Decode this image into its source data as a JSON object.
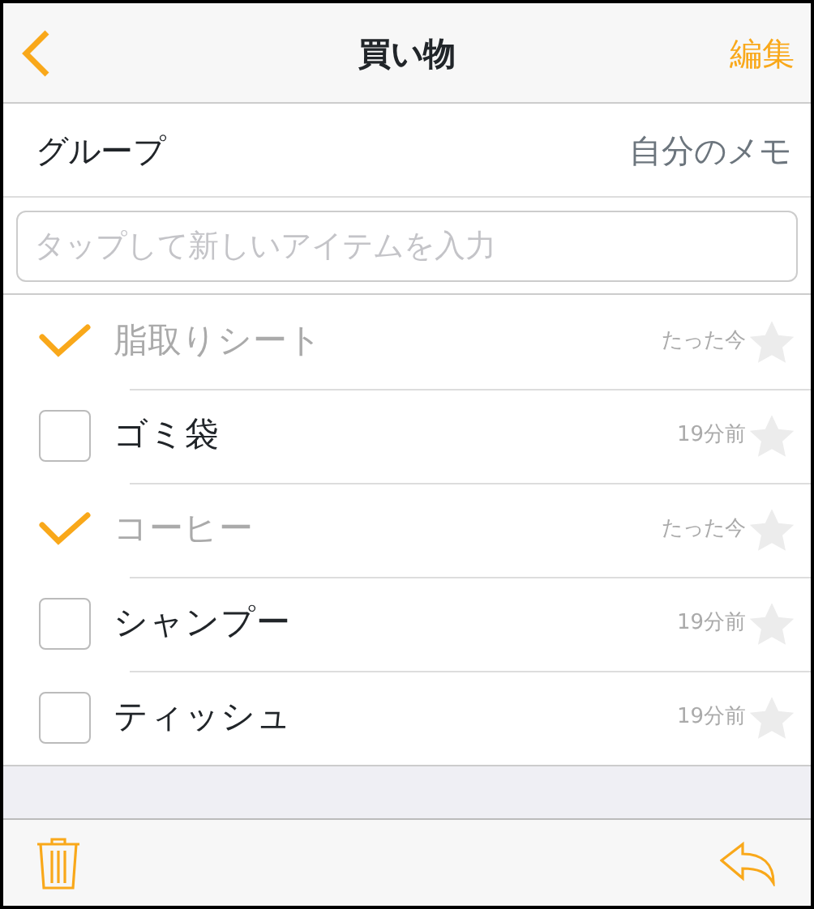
{
  "nav": {
    "title": "買い物",
    "edit": "編集"
  },
  "group": {
    "label": "グループ",
    "value": "自分のメモ"
  },
  "new_item": {
    "placeholder": "タップして新しいアイテムを入力"
  },
  "items": [
    {
      "name": "脂取りシート",
      "checked": true,
      "time": "たった今",
      "starred": false
    },
    {
      "name": "ゴミ袋",
      "checked": false,
      "time": "19分前",
      "starred": false
    },
    {
      "name": "コーヒー",
      "checked": true,
      "time": "たった今",
      "starred": false
    },
    {
      "name": "シャンプー",
      "checked": false,
      "time": "19分前",
      "starred": false
    },
    {
      "name": "ティッシュ",
      "checked": false,
      "time": "19分前",
      "starred": false
    }
  ]
}
